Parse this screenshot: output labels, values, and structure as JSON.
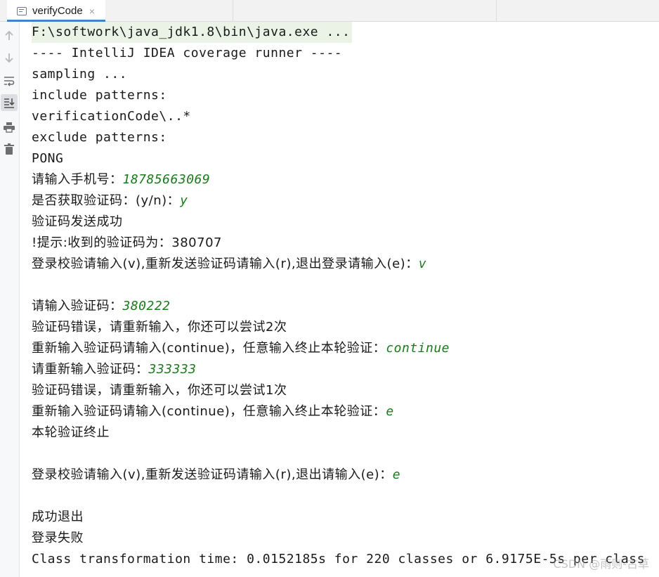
{
  "tab": {
    "title": "verifyCode",
    "close": "×"
  },
  "toolbar": {
    "up": "arrow-up-icon",
    "down": "arrow-down-icon",
    "wrap": "soft-wrap-icon",
    "scroll": "scroll-to-end-icon",
    "print": "print-icon",
    "clear": "trash-icon"
  },
  "console": {
    "command": "F:\\softwork\\java_jdk1.8\\bin\\java.exe ...",
    "l1": "---- IntelliJ IDEA coverage runner ----",
    "l2": "sampling ...",
    "l3": "include patterns:",
    "l4": "verificationCode\\..*",
    "l5": "exclude patterns:",
    "l6": "PONG",
    "l7_prompt": "请输入手机号：",
    "l7_input": "18785663069",
    "l8_prompt": "是否获取验证码：(y/n)：",
    "l8_input": "y",
    "l9": "验证码发送成功",
    "l10": "!提示:收到的验证码为：380707",
    "l11_prompt": "登录校验请输入(v),重新发送验证码请输入(r),退出登录请输入(e)：",
    "l11_input": "v",
    "l12_prompt": "请输入验证码：",
    "l12_input": "380222",
    "l13": "验证码错误，请重新输入，你还可以尝试2次",
    "l14_prompt": "重新输入验证码请输入(continue)，任意输入终止本轮验证：",
    "l14_input": "continue",
    "l15_prompt": "请重新输入验证码：",
    "l15_input": "333333",
    "l16": "验证码错误，请重新输入，你还可以尝试1次",
    "l17_prompt": "重新输入验证码请输入(continue)，任意输入终止本轮验证：",
    "l17_input": "e",
    "l18": "本轮验证终止",
    "l19_prompt": "登录校验请输入(v),重新发送验证码请输入(r),退出请输入(e)：",
    "l19_input": "e",
    "l20": "成功退出",
    "l21": "登录失败",
    "l22": "Class transformation time: 0.0152185s for 220 classes or 6.9175E-5s per class"
  },
  "watermark": "CSDN @雨则-古草",
  "colors": {
    "input": "#1b7a1b",
    "tab_accent": "#4083c9",
    "command_bg": "#eaf3e6"
  }
}
